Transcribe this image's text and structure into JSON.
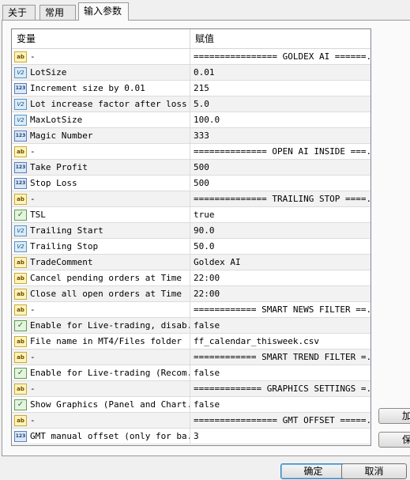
{
  "tabs": [
    {
      "label": "关于"
    },
    {
      "label": "常用"
    },
    {
      "label": "输入参数"
    }
  ],
  "grid": {
    "col_variable": "变量",
    "col_value": "赋值",
    "rows": [
      {
        "icon": "ab",
        "name": "-",
        "value": "================ GOLDEX AI ======..."
      },
      {
        "icon": "v2",
        "name": "LotSize",
        "value": "0.01"
      },
      {
        "icon": "123",
        "name": "Increment size by 0.01",
        "value": "215"
      },
      {
        "icon": "v2",
        "name": "Lot increase factor after loss",
        "value": "5.0"
      },
      {
        "icon": "v2",
        "name": "MaxLotSize",
        "value": "100.0"
      },
      {
        "icon": "123",
        "name": "Magic Number",
        "value": "333"
      },
      {
        "icon": "ab",
        "name": "-",
        "value": "============== OPEN AI INSIDE ===..."
      },
      {
        "icon": "123",
        "name": "Take Profit",
        "value": "500"
      },
      {
        "icon": "123",
        "name": "Stop Loss",
        "value": "500"
      },
      {
        "icon": "ab",
        "name": "-",
        "value": "============== TRAILING STOP ====..."
      },
      {
        "icon": "bool",
        "name": "TSL",
        "value": "true"
      },
      {
        "icon": "v2",
        "name": "Trailing Start",
        "value": "90.0"
      },
      {
        "icon": "v2",
        "name": "Trailing Stop",
        "value": "50.0"
      },
      {
        "icon": "ab",
        "name": "TradeComment",
        "value": "Goldex AI"
      },
      {
        "icon": "ab",
        "name": "Cancel pending orders at Time",
        "value": "22:00"
      },
      {
        "icon": "ab",
        "name": "Close all open orders at Time",
        "value": "22:00"
      },
      {
        "icon": "ab",
        "name": "-",
        "value": "============ SMART NEWS FILTER ==..."
      },
      {
        "icon": "bool",
        "name": "Enable for Live-trading, disab...",
        "value": "false"
      },
      {
        "icon": "ab",
        "name": "File name in MT4/Files folder",
        "value": "ff_calendar_thisweek.csv"
      },
      {
        "icon": "ab",
        "name": "-",
        "value": "============ SMART TREND FILTER =..."
      },
      {
        "icon": "bool",
        "name": "Enable for Live-trading (Recom...",
        "value": "false"
      },
      {
        "icon": "ab",
        "name": "-",
        "value": "============= GRAPHICS SETTINGS =..."
      },
      {
        "icon": "bool",
        "name": "Show Graphics (Panel and Chart...",
        "value": "false"
      },
      {
        "icon": "ab",
        "name": "-",
        "value": "================ GMT OFFSET =====..."
      },
      {
        "icon": "123",
        "name": "GMT manual offset (only for ba...",
        "value": "3"
      }
    ]
  },
  "side_buttons": {
    "load_label": "加",
    "save_label": "保"
  },
  "footer": {
    "ok_label": "确定",
    "cancel_label": "取消"
  }
}
